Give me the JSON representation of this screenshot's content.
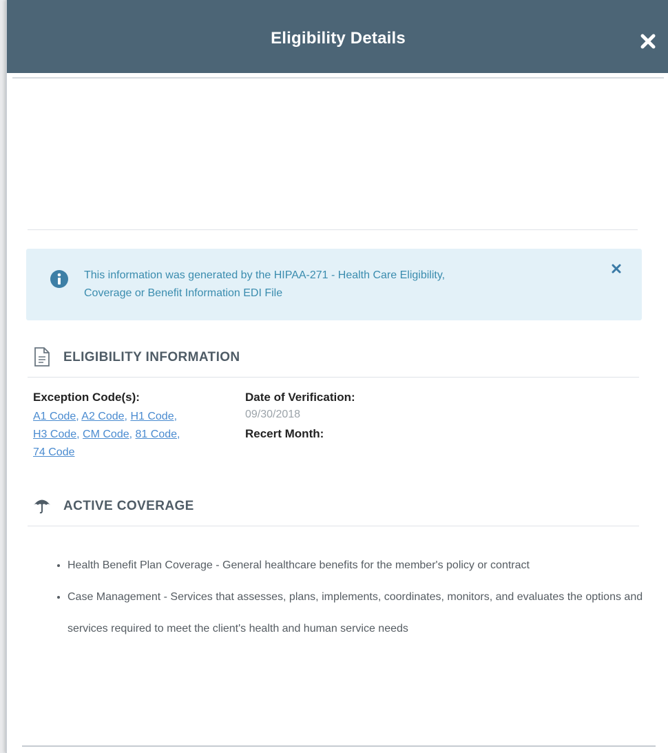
{
  "modal": {
    "title": "Eligibility Details"
  },
  "alert": {
    "line1": "This information was generated by the HIPAA-271 - Health Care Eligibility,",
    "line2": "Coverage or Benefit Information EDI File"
  },
  "eligibility": {
    "heading": "ELIGIBILITY INFORMATION",
    "exception_label": "Exception Code(s):",
    "codes": [
      "A1 Code",
      "A2 Code",
      "H1 Code",
      "H3 Code",
      "CM Code",
      "81 Code",
      "74 Code"
    ],
    "date_label": "Date of Verification:",
    "date_value": "09/30/2018",
    "recert_label": "Recert Month:"
  },
  "coverage": {
    "heading": "ACTIVE COVERAGE",
    "items": [
      "Health Benefit Plan Coverage - General healthcare benefits for the member's policy or contract",
      "Case Management - Services that assesses, plans, implements, coordinates, monitors, and evaluates the options and services required to meet the client's health and human service needs"
    ]
  },
  "colors": {
    "header_bg": "#4c6576",
    "alert_bg": "#e3f1f8",
    "alert_text": "#3a8cae",
    "link": "#4a8bd0"
  },
  "icons": {
    "close": "close-icon",
    "info": "info-circle-icon",
    "document": "document-icon",
    "umbrella": "umbrella-icon"
  }
}
